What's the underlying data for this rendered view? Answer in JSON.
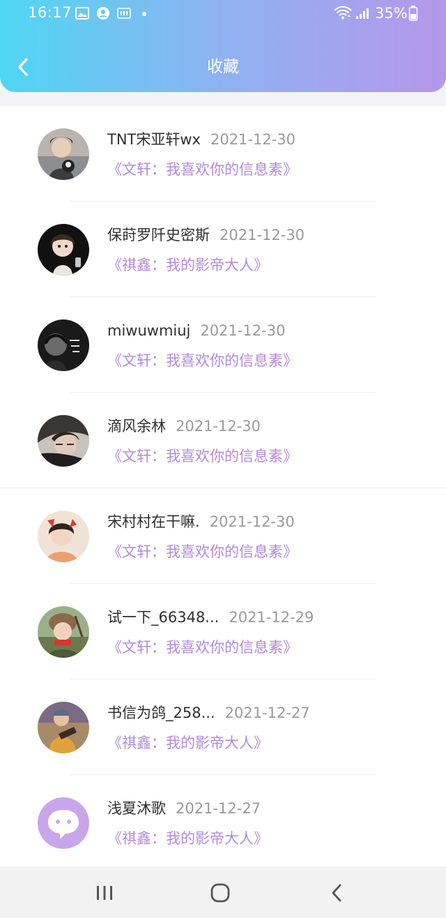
{
  "status_bar": {
    "time": "16:17",
    "battery": "35%",
    "left_icons": [
      "image-icon",
      "account-icon",
      "iqiyi-icon",
      "dot-icon"
    ],
    "right_icons": [
      "wifi-icon",
      "signal-icon",
      "battery-icon"
    ]
  },
  "header": {
    "title": "收藏",
    "back_icon": "chevron-left-icon",
    "gradient": [
      "#4fd6f3",
      "#b597ea"
    ]
  },
  "list": {
    "items": [
      {
        "name": "TNT宋亚轩wx",
        "date": "2021-12-30",
        "book": "《文轩：我喜欢你的信息素》",
        "avatar": "photo-avatar"
      },
      {
        "name": "保莳罗阡史密斯",
        "date": "2021-12-30",
        "book": "《祺鑫：我的影帝大人》",
        "avatar": "photo-avatar"
      },
      {
        "name": "miwuwmiuj",
        "date": "2021-12-30",
        "book": "《文轩：我喜欢你的信息素》",
        "avatar": "photo-avatar"
      },
      {
        "name": "滴风余林",
        "date": "2021-12-30",
        "book": "《文轩：我喜欢你的信息素》",
        "avatar": "photo-avatar"
      },
      {
        "name": "宋村村在干嘛.",
        "date": "2021-12-30",
        "book": "《文轩：我喜欢你的信息素》",
        "avatar": "photo-avatar"
      },
      {
        "name": "试一下_66348...",
        "date": "2021-12-29",
        "book": "《文轩：我喜欢你的信息素》",
        "avatar": "photo-avatar"
      },
      {
        "name": "书信为鸽_258...",
        "date": "2021-12-27",
        "book": "《祺鑫：我的影帝大人》",
        "avatar": "photo-avatar"
      },
      {
        "name": "浅夏沐歌",
        "date": "2021-12-27",
        "book": "《祺鑫：我的影帝大人》",
        "avatar": "default-chat-avatar"
      }
    ]
  },
  "nav_bar": {
    "icons": [
      "recent-apps-icon",
      "home-icon",
      "back-icon"
    ]
  },
  "colors": {
    "book_title": "#b48ad9",
    "date": "#9a9a9a",
    "name": "#2f2f2f"
  }
}
